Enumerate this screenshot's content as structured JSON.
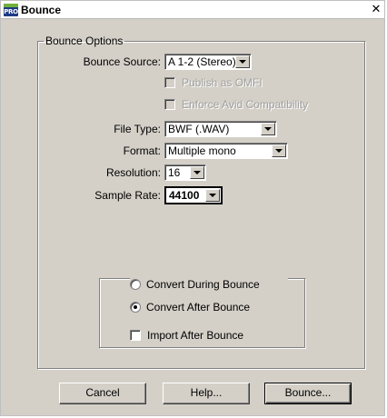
{
  "window": {
    "title": "Bounce",
    "icon_text": "PRO",
    "close_glyph": "✕"
  },
  "options": {
    "legend": "Bounce Options",
    "bounce_source_label": "Bounce Source:",
    "bounce_source_value": "A 1-2 (Stereo)",
    "publish_omfi_label": "Publish as OMFI",
    "publish_omfi_checked": false,
    "publish_omfi_enabled": false,
    "enforce_avid_label": "Enforce Avid Compatibility",
    "enforce_avid_checked": false,
    "enforce_avid_enabled": false,
    "file_type_label": "File Type:",
    "file_type_value": "BWF (.WAV)",
    "format_label": "Format:",
    "format_value": "Multiple mono",
    "resolution_label": "Resolution:",
    "resolution_value": "16",
    "sample_rate_label": "Sample Rate:",
    "sample_rate_value": "44100"
  },
  "convert": {
    "during_label": "Convert During Bounce",
    "during_selected": false,
    "after_label": "Convert After Bounce",
    "after_selected": true,
    "import_label": "Import After Bounce",
    "import_checked": false
  },
  "buttons": {
    "cancel": "Cancel",
    "help": "Help...",
    "bounce": "Bounce..."
  },
  "colors": {
    "dialog_bg": "#d4d0c8",
    "icon_blue": "#1d3a85",
    "icon_green": "#6fb13c",
    "disabled_text": "#a0a0a0"
  }
}
